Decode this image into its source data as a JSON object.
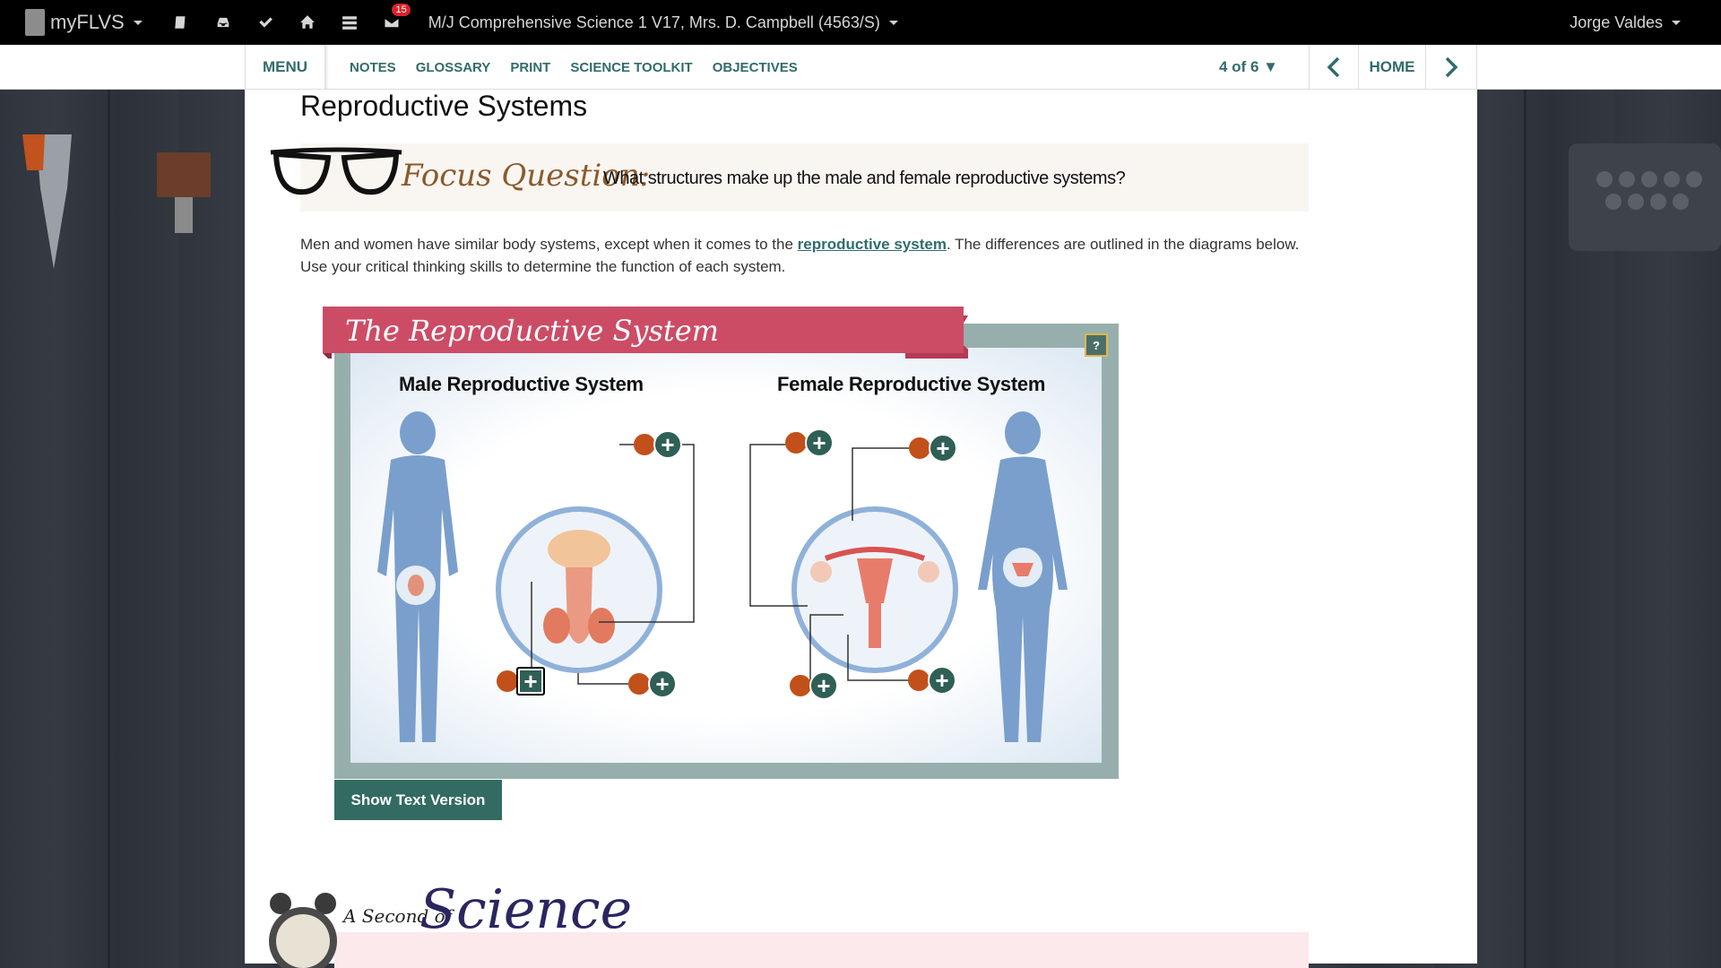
{
  "topbar": {
    "brand": "myFLVS",
    "notification_count": "15",
    "course_title": "M/J Comprehensive Science 1 V17, Mrs. D. Campbell (4563/S)",
    "user_name": "Jorge Valdes",
    "icons": [
      "book-icon",
      "inbox-icon",
      "check-icon",
      "home-icon",
      "list-icon",
      "mail-icon"
    ]
  },
  "subnav": {
    "menu": "MENU",
    "links": [
      "NOTES",
      "GLOSSARY",
      "PRINT",
      "SCIENCE TOOLKIT",
      "OBJECTIVES"
    ],
    "pager": "4 of 6 ▼",
    "home": "HOME"
  },
  "page": {
    "title": "Reproductive Systems",
    "focus_label": "Focus Question:",
    "focus_text": "What structures make up the male and female reproductive systems?",
    "intro_before": "Men and women have similar body systems, except when it comes to the ",
    "intro_link": "reproductive system",
    "intro_after": ". The differences are outlined in the diagrams below. Use your critical thinking skills to determine the function of each system."
  },
  "diagram": {
    "banner_title": "The Reproductive System",
    "help": "?",
    "male_label": "Male Reproductive System",
    "female_label": "Female Reproductive System",
    "show_text_button": "Show Text Version"
  },
  "footer": {
    "small": "A Second of",
    "big": "Science"
  },
  "colors": {
    "accent": "#336b6b",
    "banner": "#cc4c66",
    "hotspot_dot": "#c2501a",
    "hotspot_plus": "#2f5f56"
  }
}
